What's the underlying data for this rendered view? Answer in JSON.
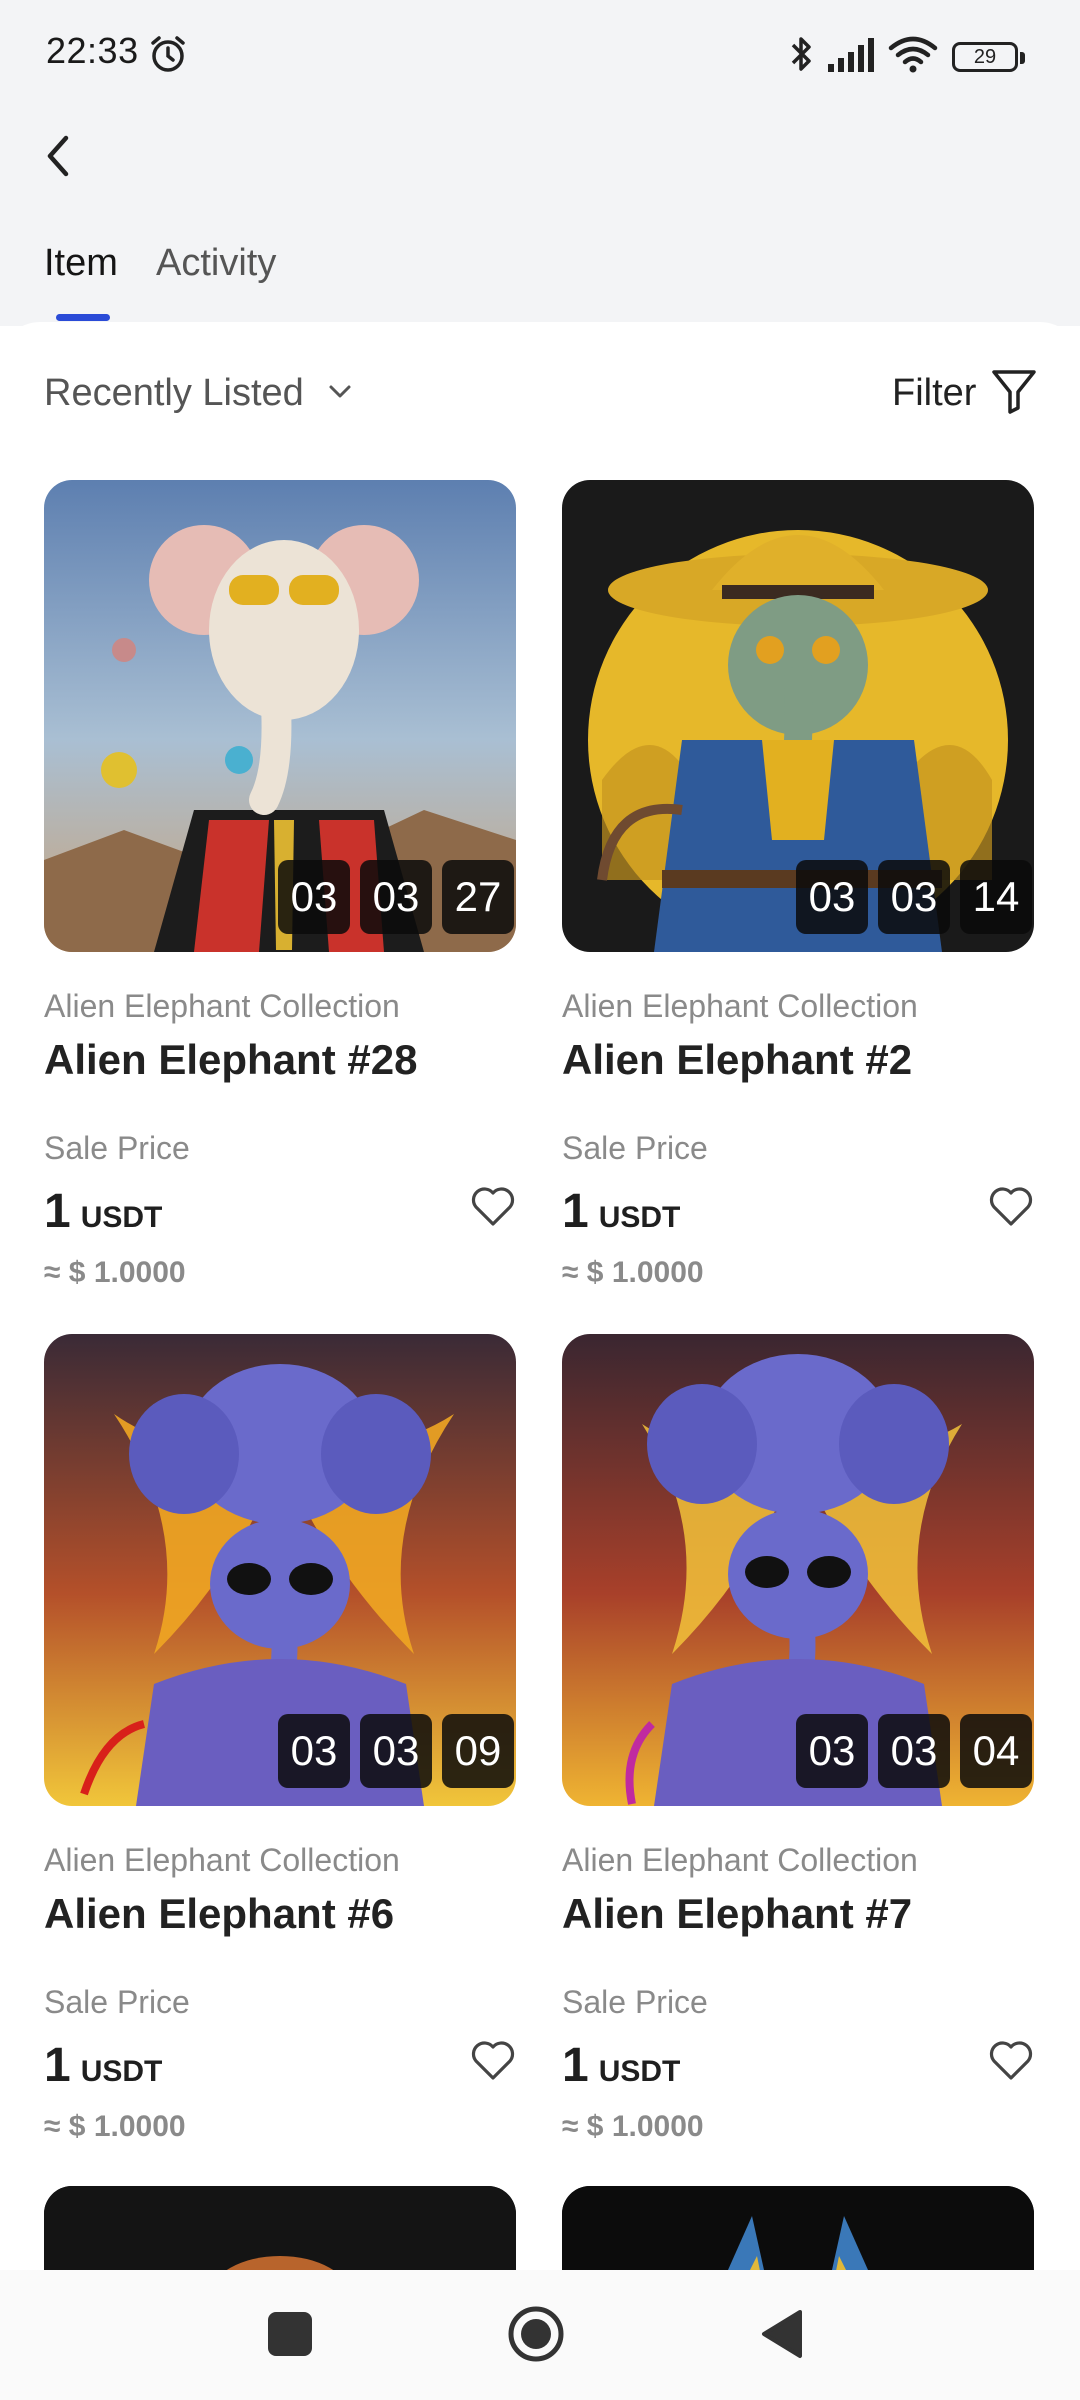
{
  "status_bar": {
    "time": "22:33",
    "battery": "29",
    "icons": [
      "alarm-icon",
      "bluetooth-icon",
      "signal-icon",
      "wifi-icon",
      "battery-icon"
    ]
  },
  "header": {
    "back_icon": "back-arrow-icon"
  },
  "tabs": [
    {
      "label": "Item",
      "active": true
    },
    {
      "label": "Activity",
      "active": false
    }
  ],
  "toolbar": {
    "sort_label": "Recently Listed",
    "filter_label": "Filter",
    "accent_color": "#2a4bd7"
  },
  "cards": [
    {
      "collection": "Alien Elephant Collection",
      "name": "Alien Elephant #28",
      "sale_label": "Sale Price",
      "price": "1",
      "currency": "USDT",
      "usd": "≈ $ 1.0000",
      "timer": [
        "03",
        "03",
        "27"
      ]
    },
    {
      "collection": "Alien Elephant Collection",
      "name": "Alien Elephant #2",
      "sale_label": "Sale Price",
      "price": "1",
      "currency": "USDT",
      "usd": "≈ $ 1.0000",
      "timer": [
        "03",
        "03",
        "14"
      ]
    },
    {
      "collection": "Alien Elephant Collection",
      "name": "Alien Elephant #6",
      "sale_label": "Sale Price",
      "price": "1",
      "currency": "USDT",
      "usd": "≈ $ 1.0000",
      "timer": [
        "03",
        "03",
        "09"
      ]
    },
    {
      "collection": "Alien Elephant Collection",
      "name": "Alien Elephant #7",
      "sale_label": "Sale Price",
      "price": "1",
      "currency": "USDT",
      "usd": "≈ $ 1.0000",
      "timer": [
        "03",
        "03",
        "04"
      ]
    }
  ],
  "nav_bar": {
    "icons": [
      "recents-square-icon",
      "home-circle-icon",
      "back-triangle-icon"
    ]
  }
}
